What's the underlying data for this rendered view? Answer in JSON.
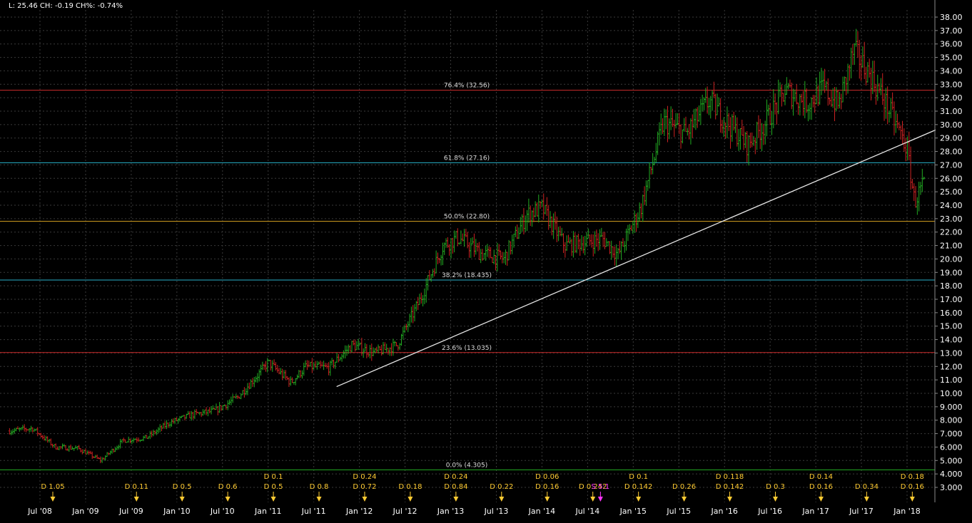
{
  "header": {
    "ohlc_readout": "L: 25.46 CH: -0.19 CH%: -0.74%"
  },
  "colors": {
    "background": "#000000",
    "grid": "#3a3a3a",
    "axis_text": "#ffffff",
    "up_bar": "#22aa22",
    "down_bar": "#cc2222",
    "fib_red": "#cc2b2b",
    "fib_cyan": "#28b0c8",
    "fib_orange": "#d4a020",
    "fib_green": "#22aa22",
    "trendline": "#e8e8e8",
    "dividend": "#ffcc33",
    "split": "#ff33ff"
  },
  "chart_data": {
    "type": "line",
    "title": "",
    "xlabel": "",
    "ylabel": "",
    "ylim": [
      2.3,
      38.6
    ],
    "y_ticks": [
      "38.00",
      "37.00",
      "36.00",
      "35.00",
      "34.00",
      "33.00",
      "32.00",
      "31.00",
      "30.00",
      "29.00",
      "28.00",
      "27.00",
      "26.00",
      "25.00",
      "24.00",
      "23.00",
      "22.00",
      "21.00",
      "20.00",
      "19.00",
      "18.00",
      "17.00",
      "16.00",
      "15.00",
      "14.00",
      "13.00",
      "12.00",
      "11.00",
      "10.00",
      "9.000",
      "8.000",
      "7.000",
      "6.000",
      "5.000",
      "4.000",
      "3.000"
    ],
    "x_ticks": [
      "Jul '08",
      "Jan '09",
      "Jul '09",
      "Jan '10",
      "Jul '10",
      "Jan '11",
      "Jul '11",
      "Jan '12",
      "Jul '12",
      "Jan '13",
      "Jul '13",
      "Jan '14",
      "Jul '14",
      "Jan '15",
      "Jul '15",
      "Jan '16",
      "Jul '16",
      "Jan '17",
      "Jul '17",
      "Jan '18"
    ],
    "grid": true,
    "series": [
      {
        "x": [
          "2008-03",
          "2008-06",
          "2008-09",
          "2008-12",
          "2009-03",
          "2009-06",
          "2009-09",
          "2009-12",
          "2010-03",
          "2010-06",
          "2010-09",
          "2010-12",
          "2011-01",
          "2011-04",
          "2011-06",
          "2011-09",
          "2011-12",
          "2012-03",
          "2012-06",
          "2012-09",
          "2012-12",
          "2013-02",
          "2013-05",
          "2013-08",
          "2013-11",
          "2014-01",
          "2014-04",
          "2014-06",
          "2014-09",
          "2014-11",
          "2015-02",
          "2015-05",
          "2015-08",
          "2015-11",
          "2016-01",
          "2016-04",
          "2016-06",
          "2016-09",
          "2016-12",
          "2017-02",
          "2017-04",
          "2017-06",
          "2017-08",
          "2017-10",
          "2017-12",
          "2018-01",
          "2018-02",
          "2018-03"
        ],
        "values": [
          7.2,
          7.4,
          6.0,
          5.9,
          5.0,
          6.5,
          6.7,
          7.8,
          8.4,
          8.7,
          9.7,
          11.6,
          12.3,
          10.8,
          12.0,
          11.9,
          13.6,
          13.0,
          13.6,
          17.0,
          21.0,
          21.6,
          20.4,
          20.0,
          23.3,
          23.8,
          21.0,
          21.2,
          21.5,
          20.3,
          23.8,
          30.2,
          29.3,
          31.8,
          30.4,
          28.5,
          29.8,
          32.5,
          31.6,
          32.7,
          31.4,
          35.5,
          33.8,
          31.8,
          29.5,
          28.2,
          24.2,
          25.46
        ]
      }
    ],
    "fib_levels": [
      {
        "label": "76.4% (32.56)",
        "value": 32.56,
        "color": "#cc2b2b"
      },
      {
        "label": "61.8% (27.16)",
        "value": 27.16,
        "color": "#28b0c8"
      },
      {
        "label": "50.0% (22.80)",
        "value": 22.8,
        "color": "#d4a020"
      },
      {
        "label": "38.2% (18.435)",
        "value": 18.435,
        "color": "#28b0c8"
      },
      {
        "label": "23.6% (13.035)",
        "value": 13.035,
        "color": "#cc2b2b"
      },
      {
        "label": "0.0% (4.305)",
        "value": 4.305,
        "color": "#22aa22"
      }
    ],
    "trendline": {
      "start": [
        "2011-10",
        10.5
      ],
      "end": [
        "2018-04",
        29.6
      ]
    },
    "events": [
      {
        "date": "2008-07",
        "labels": [
          "D 1.05"
        ]
      },
      {
        "date": "2009-06",
        "labels": [
          "D 0.11"
        ]
      },
      {
        "date": "2009-12",
        "labels": [
          "D 0.5"
        ]
      },
      {
        "date": "2010-06",
        "labels": [
          "D 0.6"
        ]
      },
      {
        "date": "2010-12",
        "labels": [
          "D 0.1",
          "D 0.5"
        ]
      },
      {
        "date": "2011-06",
        "labels": [
          "D 0.8"
        ]
      },
      {
        "date": "2011-12",
        "labels": [
          "D 0.24",
          "D 0.72"
        ]
      },
      {
        "date": "2012-06",
        "labels": [
          "D 0.18"
        ]
      },
      {
        "date": "2012-12",
        "labels": [
          "D 0.24",
          "D 0.84"
        ]
      },
      {
        "date": "2013-06",
        "labels": [
          "D 0.22"
        ]
      },
      {
        "date": "2013-12",
        "labels": [
          "D 0.06",
          "D 0.16"
        ]
      },
      {
        "date": "2014-06",
        "labels": [
          "D 0.242"
        ]
      },
      {
        "date": "2014-07",
        "labels": [
          "S 5:1"
        ],
        "split": true
      },
      {
        "date": "2014-12",
        "labels": [
          "D 0.1",
          "D 0.142"
        ]
      },
      {
        "date": "2015-06",
        "labels": [
          "D 0.26"
        ]
      },
      {
        "date": "2015-12",
        "labels": [
          "D 0.118",
          "D 0.142"
        ]
      },
      {
        "date": "2016-06",
        "labels": [
          "D 0.3"
        ]
      },
      {
        "date": "2016-12",
        "labels": [
          "D 0.14",
          "D 0.16"
        ]
      },
      {
        "date": "2017-06",
        "labels": [
          "D 0.34"
        ]
      },
      {
        "date": "2017-12",
        "labels": [
          "D 0.18",
          "D 0.16"
        ]
      }
    ]
  }
}
